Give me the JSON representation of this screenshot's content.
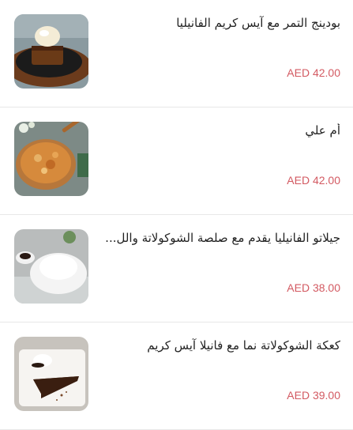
{
  "items": [
    {
      "title": "بودينج التمر مع آيس كريم الفانيليا",
      "price": "AED 42.00",
      "image": "date-pudding-photo"
    },
    {
      "title": "أم علي",
      "price": "AED 42.00",
      "image": "umm-ali-photo"
    },
    {
      "title": "جيلاتو الفانيليا يقدم مع صلصة الشوكولاتة والل",
      "price": "AED 38.00",
      "image": "vanilla-gelato-photo"
    },
    {
      "title": "كعكة الشوكولاتة نما مع فانيلا آيس كريم",
      "price": "AED 39.00",
      "image": "chocolate-cake-photo"
    }
  ],
  "colors": {
    "price": "#d35a62",
    "title": "#222222",
    "divider": "#e8e8e8"
  }
}
